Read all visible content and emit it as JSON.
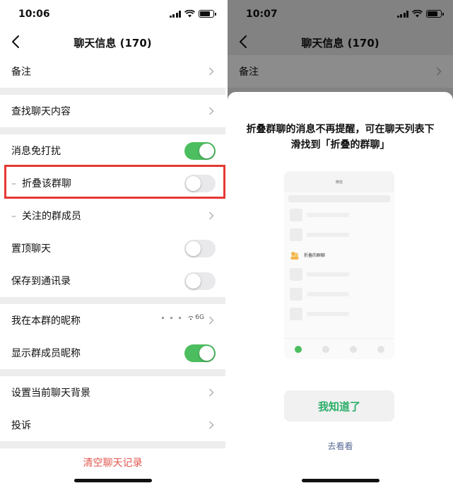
{
  "left": {
    "status_time": "10:06",
    "title": "聊天信息 (170)",
    "rows": {
      "remark": "备注",
      "search": "查找聊天内容",
      "mute": "消息免打扰",
      "fold": "折叠该群聊",
      "followed": "关注的群成员",
      "pin": "置顶聊天",
      "save_contacts": "保存到通讯录",
      "nickname": "我在本群的昵称",
      "show_nicknames": "显示群成员昵称",
      "background": "设置当前聊天背景",
      "complain": "投诉"
    },
    "nickname_value": "6G",
    "clear_history": "清空聊天记录",
    "toggles": {
      "mute": true,
      "fold": false,
      "pin": false,
      "save_contacts": false,
      "show_nicknames": true
    }
  },
  "right": {
    "status_time": "10:07",
    "title": "聊天信息 (170)",
    "remark": "备注",
    "sheet_title": "折叠群聊的消息不再提醒，可在聊天列表下滑找到「折叠的群聊」",
    "preview_header": "微信",
    "preview_folded_label": "折叠的群聊",
    "confirm_button": "我知道了",
    "go_look": "去看看"
  },
  "colors": {
    "toggle_on": "#4cbe5f",
    "highlight": "#e53935",
    "danger_text": "#e2564d",
    "confirm_text": "#2aae67",
    "link": "#576b95"
  },
  "icons": {
    "back": "chevron-left-icon",
    "row_arrow": "chevron-right-icon"
  }
}
